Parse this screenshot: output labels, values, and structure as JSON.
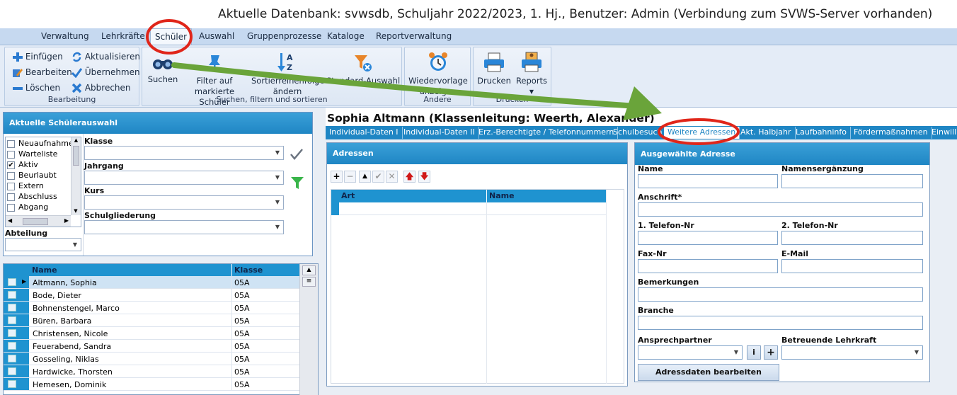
{
  "window": {
    "title": "Aktuelle Datenbank: svwsdb, Schuljahr 2022/2023, 1. Hj., Benutzer: Admin (Verbindung zum SVWS-Server vorhanden)"
  },
  "menu": {
    "items": [
      "Verwaltung",
      "Lehrkräfte",
      "Schüler",
      "Auswahl",
      "Gruppenprozesse",
      "Kataloge",
      "Reportverwaltung"
    ],
    "active": "Schüler"
  },
  "ribbon": {
    "bearbeitung": {
      "label": "Bearbeitung",
      "einfuegen": "Einfügen",
      "bearbeiten": "Bearbeiten",
      "loeschen": "Löschen",
      "aktualisieren": "Aktualisieren",
      "uebernehmen": "Übernehmen",
      "abbrechen": "Abbrechen"
    },
    "suchen": {
      "label": "Suchen, filtern und sortieren",
      "suchen": "Suchen",
      "filter_line1": "Filter auf",
      "filter_line2": "markierte Schüler",
      "sort_line1": "Sortierreihenfolge",
      "sort_line2": "ändern",
      "standard": "Standard-Auswahl"
    },
    "andere": {
      "label": "Andere",
      "wv_line1": "Wiedervorlage",
      "wv_line2": "anzeigen"
    },
    "drucken": {
      "label": "Drucken",
      "drucken": "Drucken",
      "reports": "Reports"
    }
  },
  "selection_panel": {
    "title": "Aktuelle Schülerauswahl",
    "status_items": [
      {
        "label": "Neuaufnahme",
        "checked": false
      },
      {
        "label": "Warteliste",
        "checked": false
      },
      {
        "label": "Aktiv",
        "checked": true
      },
      {
        "label": "Beurlaubt",
        "checked": false
      },
      {
        "label": "Extern",
        "checked": false
      },
      {
        "label": "Abschluss",
        "checked": false
      },
      {
        "label": "Abgang",
        "checked": false
      }
    ],
    "klasse_label": "Klasse",
    "jahrgang_label": "Jahrgang",
    "kurs_label": "Kurs",
    "schulgliederung_label": "Schulgliederung",
    "abteilung_label": "Abteilung"
  },
  "student_grid": {
    "col_name": "Name",
    "col_klasse": "Klasse",
    "rows": [
      {
        "name": "Altmann, Sophia",
        "klasse": "05A"
      },
      {
        "name": "Bode, Dieter",
        "klasse": "05A"
      },
      {
        "name": "Bohnenstengel, Marco",
        "klasse": "05A"
      },
      {
        "name": "Büren, Barbara",
        "klasse": "05A"
      },
      {
        "name": "Christensen, Nicole",
        "klasse": "05A"
      },
      {
        "name": "Feuerabend, Sandra",
        "klasse": "05A"
      },
      {
        "name": "Gosseling, Niklas",
        "klasse": "05A"
      },
      {
        "name": "Hardwicke, Thorsten",
        "klasse": "05A"
      },
      {
        "name": "Hemesen, Dominik",
        "klasse": "05A"
      }
    ]
  },
  "student_header": "Sophia Altmann (Klassenleitung: Weerth, Alexander)",
  "tabs": [
    "Individual-Daten I",
    "Individual-Daten II",
    "Erz.-Berechtigte / Telefonnummern",
    "Schulbesuch",
    "Weitere Adressen",
    "Akt. Halbjahr",
    "Laufbahninfo",
    "Fördermaßnahmen",
    "Einwilli"
  ],
  "active_tab": "Weitere Adressen",
  "adressen": {
    "title": "Adressen",
    "col_art": "Art",
    "col_name": "Name"
  },
  "detail": {
    "title": "Ausgewählte Adresse",
    "name": "Name",
    "namensergaenzung": "Namensergänzung",
    "anschrift": "Anschrift*",
    "tel1": "1. Telefon-Nr",
    "tel2": "2. Telefon-Nr",
    "fax": "Fax-Nr",
    "email": "E-Mail",
    "bemerkungen": "Bemerkungen",
    "branche": "Branche",
    "ansprechpartner": "Ansprechpartner",
    "betreuende": "Betreuende Lehrkraft",
    "info_btn": "i",
    "add_btn": "+",
    "edit_btn": "Adressdaten bearbeiten"
  },
  "colors": {
    "accent_blue": "#1f86c4",
    "annotation_red": "#e0261a",
    "annotation_green": "#6aa43a"
  }
}
